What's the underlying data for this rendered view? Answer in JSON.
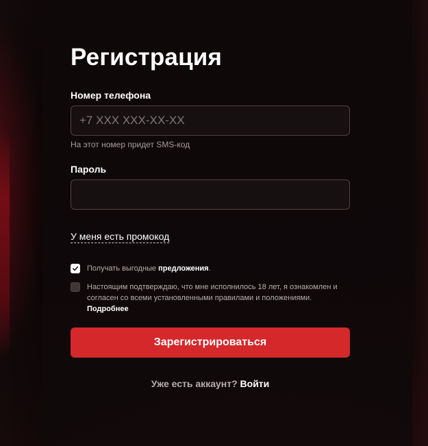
{
  "page": {
    "title": "Регистрация"
  },
  "phone": {
    "label": "Номер телефона",
    "value": "",
    "placeholder": "+7 XXX XXX-XX-XX",
    "hint": "На этот номер придет SMS-код"
  },
  "password": {
    "label": "Пароль",
    "value": "",
    "placeholder": ""
  },
  "promo": {
    "link": "У меня есть промокод"
  },
  "consents": {
    "offers": {
      "checked": true,
      "text_prefix": "Получать выгодные ",
      "text_bold": "предложения",
      "text_suffix": "."
    },
    "age": {
      "checked": false,
      "text": "Настоящим подтверждаю, что мне исполнилось 18 лет, я ознакомлен и согласен со всеми установленными правилами и положениями.",
      "more_link": "Подробнее"
    }
  },
  "submit": {
    "label": "Зарегистрироваться"
  },
  "login": {
    "prompt": "Уже есть аккаунт?",
    "link": "Войти"
  },
  "colors": {
    "accent": "#d5282b",
    "background": "#0e0708",
    "input_border": "#4d4445"
  }
}
